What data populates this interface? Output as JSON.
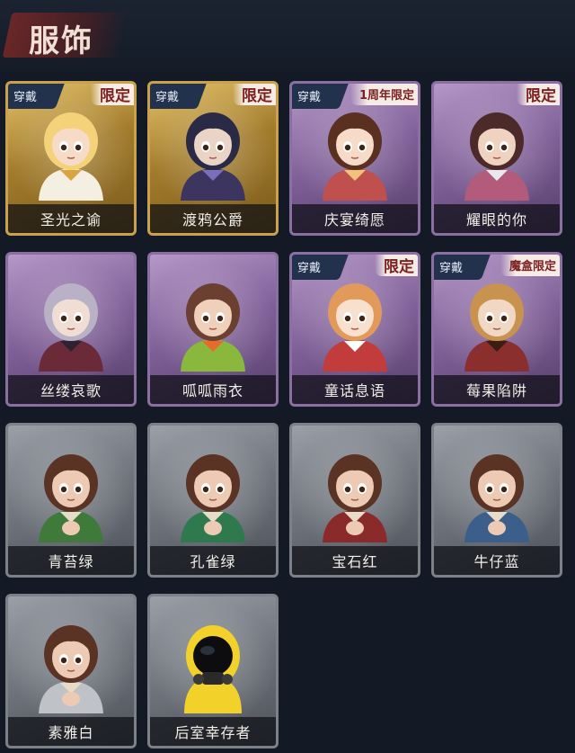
{
  "page": {
    "title": "服饰"
  },
  "cards": [
    {
      "name": "圣光之谕",
      "rarity": "gold",
      "worn_label": "穿戴",
      "tag": "限定",
      "hair": "#f3d27a",
      "skin": "#f6dcc8",
      "cloth": "#f4efe0",
      "accent": "#d9a441"
    },
    {
      "name": "渡鸦公爵",
      "rarity": "gold",
      "worn_label": "穿戴",
      "tag": "限定",
      "hair": "#2b2a46",
      "skin": "#e9d4c6",
      "cloth": "#3b3560",
      "accent": "#7a6fb8"
    },
    {
      "name": "庆宴绮愿",
      "rarity": "purple",
      "worn_label": "穿戴",
      "tag": "1周年限定",
      "hair": "#5a3020",
      "skin": "#f6dcc8",
      "cloth": "#c0504d",
      "accent": "#f0c27c"
    },
    {
      "name": "耀眼的你",
      "rarity": "purple",
      "worn_label": "",
      "tag": "限定",
      "hair": "#4c2a2a",
      "skin": "#f0d2c0",
      "cloth": "#b25b7a",
      "accent": "#e8e8ef"
    },
    {
      "name": "丝缕哀歌",
      "rarity": "purple",
      "worn_label": "",
      "tag": "",
      "hair": "#b9b2c6",
      "skin": "#f0ddd4",
      "cloth": "#6b2a38",
      "accent": "#2d2230"
    },
    {
      "name": "呱呱雨衣",
      "rarity": "purple",
      "worn_label": "",
      "tag": "",
      "hair": "#6b4030",
      "skin": "#efd0ba",
      "cloth": "#8ab83c",
      "accent": "#e86a2c"
    },
    {
      "name": "童话息语",
      "rarity": "purple",
      "worn_label": "穿戴",
      "tag": "限定",
      "hair": "#e29a5a",
      "skin": "#f8e0cf",
      "cloth": "#c23c3c",
      "accent": "#ffffff"
    },
    {
      "name": "莓果陷阱",
      "rarity": "purple",
      "worn_label": "穿戴",
      "tag": "魔盒限定",
      "hair": "#c8924f",
      "skin": "#f1d8c4",
      "cloth": "#8a2e2e",
      "accent": "#3a1e14"
    },
    {
      "name": "青苔绿",
      "rarity": "gray",
      "worn_label": "",
      "tag": "",
      "hair": "#5a3324",
      "skin": "#eccab4",
      "cloth": "#3f7a3a",
      "accent": "#e8dcc8"
    },
    {
      "name": "孔雀绿",
      "rarity": "gray",
      "worn_label": "",
      "tag": "",
      "hair": "#5a3324",
      "skin": "#eccab4",
      "cloth": "#2e7a4e",
      "accent": "#e8dcc8"
    },
    {
      "name": "宝石红",
      "rarity": "gray",
      "worn_label": "",
      "tag": "",
      "hair": "#5a3324",
      "skin": "#eccab4",
      "cloth": "#8a2a2a",
      "accent": "#e8dcc8"
    },
    {
      "name": "牛仔蓝",
      "rarity": "gray",
      "worn_label": "",
      "tag": "",
      "hair": "#5a3324",
      "skin": "#eccab4",
      "cloth": "#3b5f8a",
      "accent": "#e8dcc8"
    },
    {
      "name": "素雅白",
      "rarity": "gray",
      "worn_label": "",
      "tag": "",
      "hair": "#5a3324",
      "skin": "#eccab4",
      "cloth": "#bfc3c8",
      "accent": "#e8dcc8"
    },
    {
      "name": "后室幸存者",
      "rarity": "gray",
      "worn_label": "",
      "tag": "",
      "hair": "#111111",
      "skin": "#222222",
      "cloth": "#f2d22a",
      "accent": "#1b1b1b"
    }
  ]
}
